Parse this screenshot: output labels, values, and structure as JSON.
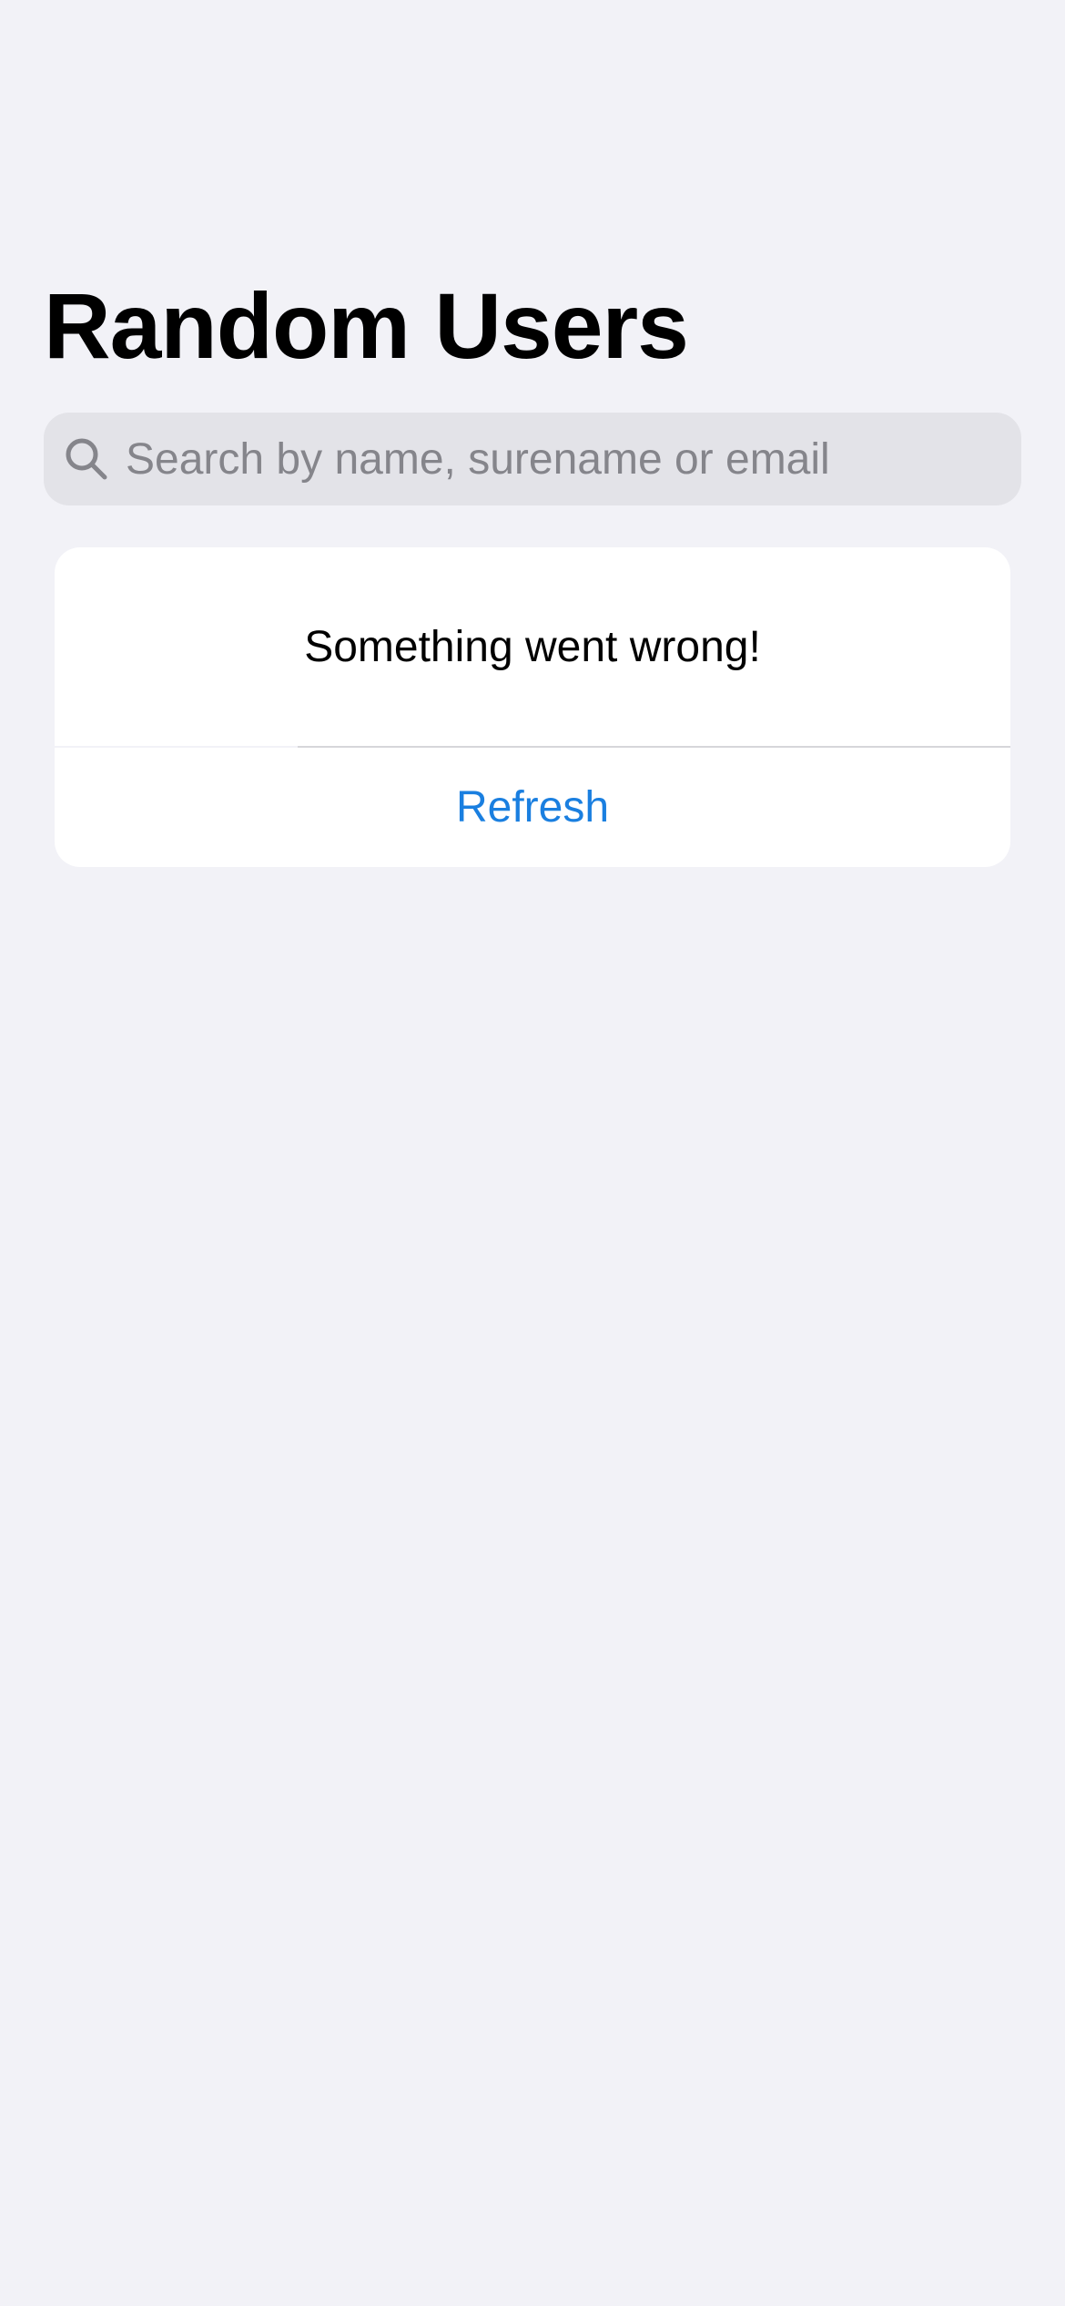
{
  "header": {
    "title": "Random Users"
  },
  "search": {
    "placeholder": "Search by name, surename or email",
    "value": "",
    "icon": "magnifying-glass"
  },
  "error_state": {
    "message": "Something went wrong!",
    "action_label": "Refresh"
  },
  "colors": {
    "background": "#f2f2f7",
    "search_field": "#e3e3e8",
    "card": "#ffffff",
    "accent": "#1a7fe0",
    "placeholder": "#85858b"
  }
}
